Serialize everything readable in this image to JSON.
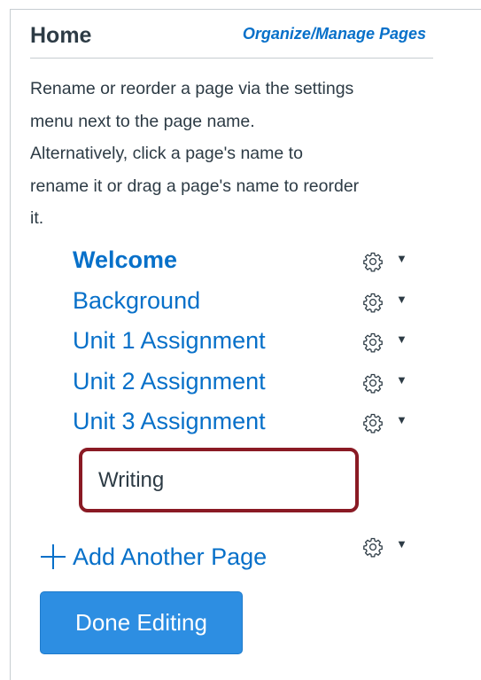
{
  "header": {
    "title": "Home",
    "manage_link": "Organize/Manage Pages"
  },
  "instructions": {
    "lines": [
      "Rename or reorder a page via the settings",
      "menu next to the page name.",
      "Alternatively, click a page's name to",
      "rename it or drag a page's name to reorder",
      "it."
    ]
  },
  "pages": [
    {
      "label": "Welcome",
      "bold": true,
      "icon": "gear-icon"
    },
    {
      "label": "Background",
      "bold": false,
      "icon": "gear-icon"
    },
    {
      "label": "Unit 1 Assignment",
      "bold": false,
      "icon": "gear-icon"
    },
    {
      "label": "Unit 2 Assignment",
      "bold": false,
      "icon": "gear-icon"
    },
    {
      "label": "Unit 3 Assignment",
      "bold": false,
      "icon": "gear-icon"
    }
  ],
  "new_page_input": {
    "value": "Writing"
  },
  "add_page": {
    "label": "Add Another Page",
    "icon": "plus-icon"
  },
  "done_button": {
    "label": "Done Editing"
  },
  "colors": {
    "link": "#0770c9",
    "text": "#2d3b45",
    "highlight_border": "#8a1a24",
    "button": "#2d8ee2"
  }
}
